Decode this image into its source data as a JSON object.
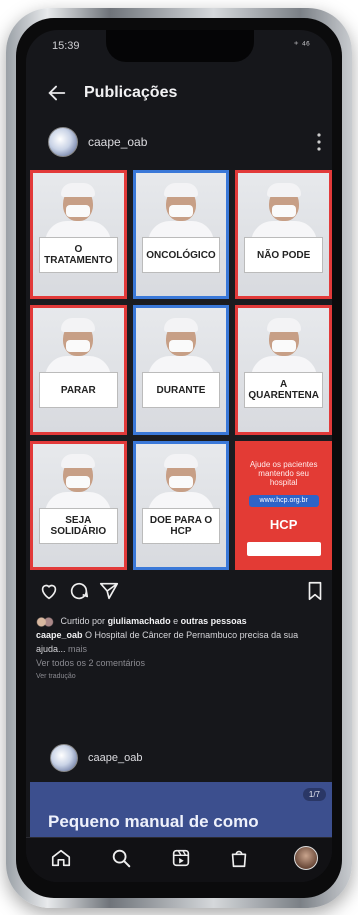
{
  "status": {
    "time": "15:39",
    "indicators": "⁺ ⁴⁶"
  },
  "header": {
    "title": "Publicações"
  },
  "post": {
    "username": "caape_oab",
    "tiles": [
      {
        "sign": "O TRATAMENTO",
        "border": "red"
      },
      {
        "sign": "ONCOLÓGICO",
        "border": "blue"
      },
      {
        "sign": "NÃO PODE",
        "border": "red"
      },
      {
        "sign": "PARAR",
        "border": "red"
      },
      {
        "sign": "DURANTE",
        "border": "blue"
      },
      {
        "sign": "A QUARENTENA",
        "border": "red"
      },
      {
        "sign": "SEJA SOLIDÁRIO",
        "border": "red"
      },
      {
        "sign": "DOE PARA O HCP",
        "border": "blue"
      }
    ],
    "promo": {
      "text": "Ajude os pacientes mantendo seu hospital",
      "link": "www.hcp.org.br",
      "logo": "HCP",
      "color": "#e33b35"
    },
    "liked_prefix": "Curtido por",
    "liked_user": "giuliamachado",
    "liked_and": "e",
    "liked_others": "outras pessoas",
    "caption_user": "caape_oab",
    "caption_text": "O Hospital de Câncer de Pernambuco precisa da sua ajuda...",
    "caption_more": "mais",
    "comments_link": "Ver todos os 2 comentários",
    "translation": "Ver tradução"
  },
  "post2": {
    "username": "caape_oab",
    "banner_text": "Pequeno manual de como",
    "banner_badge": "1/7"
  },
  "colors": {
    "accent_red": "#e23a3a",
    "accent_blue": "#3a78d8",
    "banner_blue": "#3c4f8e"
  },
  "icons": {
    "back": "arrow-left-icon",
    "more": "more-vertical-icon",
    "like": "heart-icon",
    "comment": "comment-icon",
    "share": "send-icon",
    "save": "bookmark-icon",
    "home": "home-icon",
    "search": "search-icon",
    "reels": "reels-icon",
    "shop": "shop-icon"
  }
}
